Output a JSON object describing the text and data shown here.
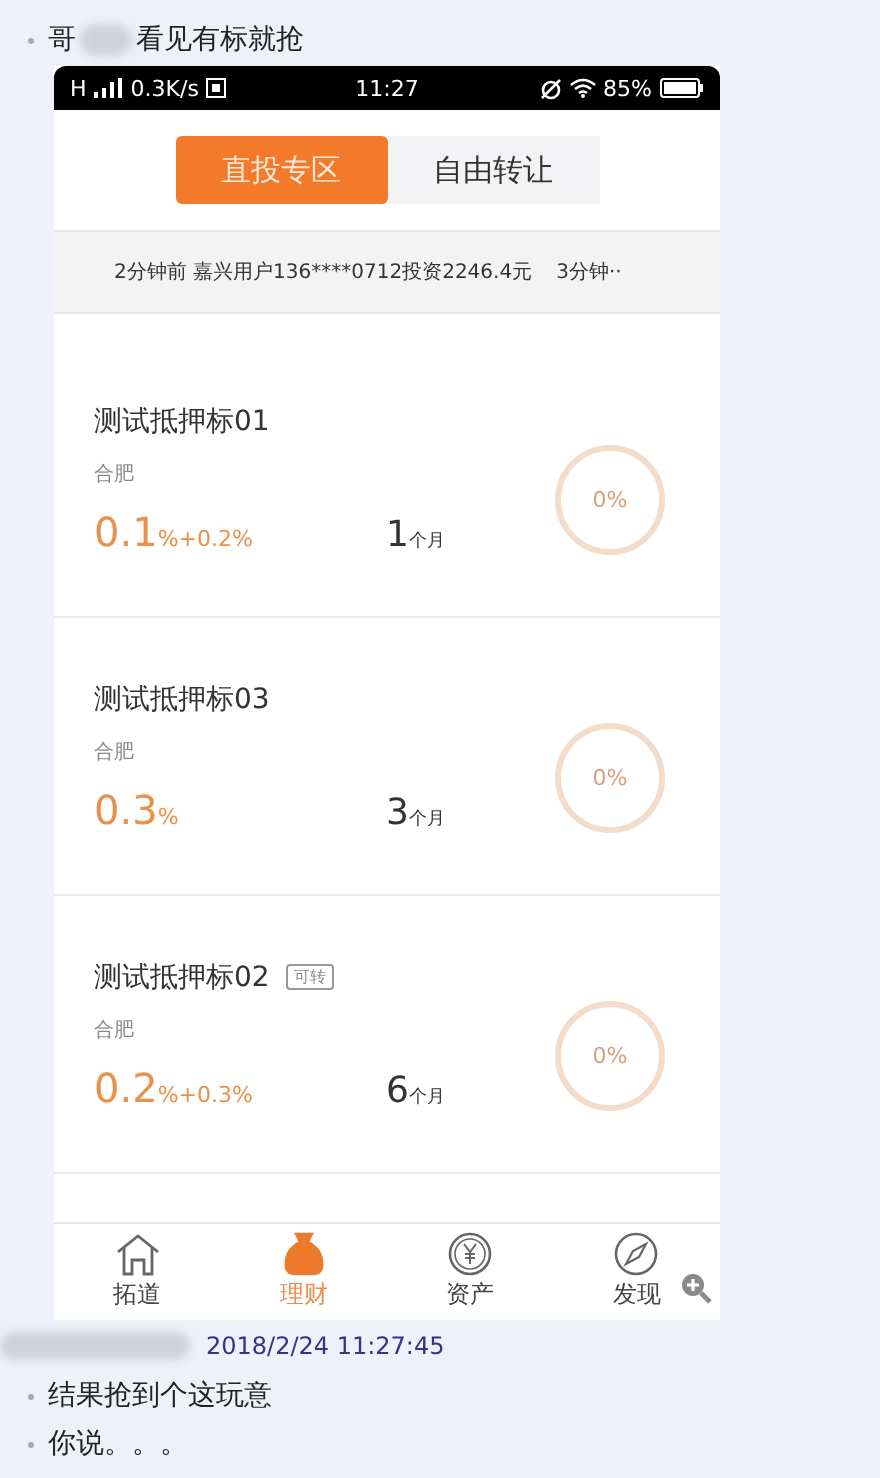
{
  "first_message": {
    "before": "哥",
    "after": "看见有标就抢"
  },
  "phone": {
    "status_bar": {
      "network": "H",
      "speed": "0.3K/s",
      "time": "11:27",
      "battery": "85%"
    },
    "segments": [
      {
        "label": "直投专区",
        "selected": true
      },
      {
        "label": "自由转让",
        "selected": false
      }
    ],
    "ticker": [
      "2分钟前 嘉兴用户136****0712投资2246.4元",
      "3分钟··"
    ],
    "loans": [
      {
        "name": "测试抵押标01",
        "city": "合肥",
        "rate": "0.1",
        "rate_suffix": "%+0.2%",
        "term": "1",
        "term_unit": "个月",
        "progress_text": "0%"
      },
      {
        "name": "测试抵押标03",
        "city": "合肥",
        "rate": "0.3",
        "rate_suffix": "%",
        "term": "3",
        "term_unit": "个月",
        "progress_text": "0%"
      },
      {
        "name": "测试抵押标02",
        "tag": "可转",
        "city": "合肥",
        "rate": "0.2",
        "rate_suffix": "%+0.3%",
        "term": "6",
        "term_unit": "个月",
        "progress_text": "0%"
      }
    ],
    "tabs": [
      {
        "label": "拓道",
        "selected": false
      },
      {
        "label": "理财",
        "selected": true
      },
      {
        "label": "资产",
        "selected": false
      },
      {
        "label": "发现",
        "selected": false
      }
    ]
  },
  "reply": {
    "timestamp": "2018/2/24 11:27:45",
    "lines": [
      "结果抢到个这玩意",
      "你说。。。"
    ]
  }
}
